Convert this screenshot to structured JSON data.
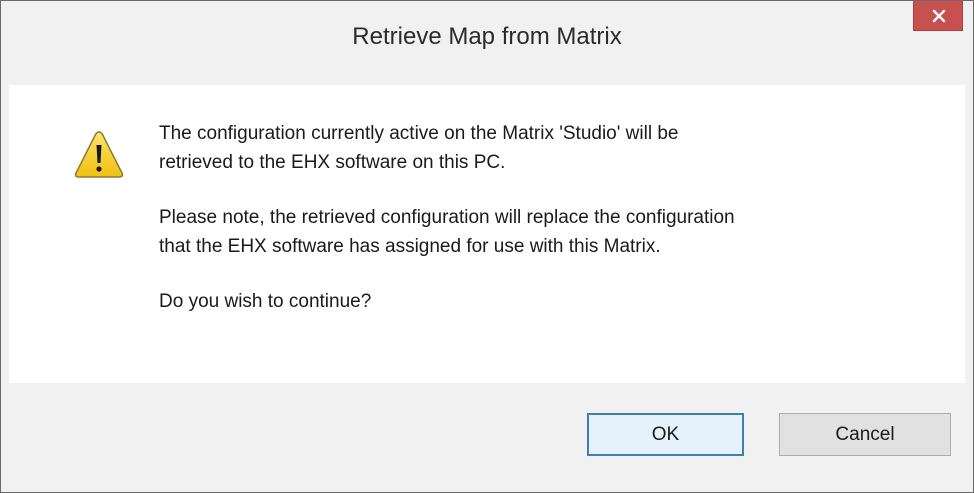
{
  "dialog": {
    "title": "Retrieve Map from Matrix",
    "close_glyph": "×",
    "icon": "warning-icon",
    "message_paragraphs": [
      "The configuration currently active on the Matrix 'Studio' will be\nretrieved to the EHX software on this PC.",
      "Please note, the retrieved configuration will replace the configuration\nthat the EHX software has assigned for use with this Matrix.",
      "Do you wish to continue?"
    ],
    "buttons": {
      "ok_label": "OK",
      "cancel_label": "Cancel"
    }
  },
  "colors": {
    "close_button": "#c75050",
    "ok_border": "#3c7fb1",
    "warning_fill": "#f7d21f"
  }
}
